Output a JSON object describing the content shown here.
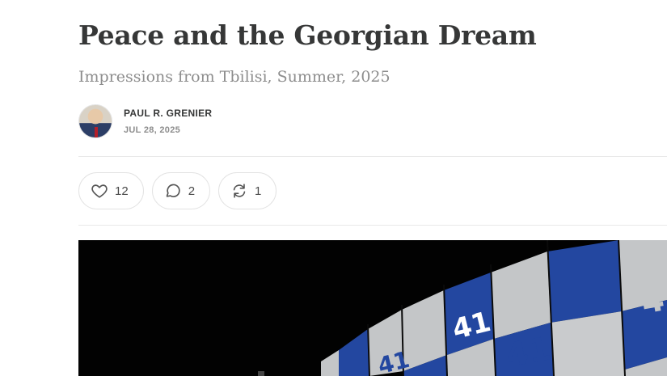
{
  "post": {
    "title": "Peace and the Georgian Dream",
    "subtitle": "Impressions from Tbilisi, Summer, 2025",
    "author": "PAUL R. GRENIER",
    "date": "JUL 28, 2025"
  },
  "actions": {
    "likes": "12",
    "comments": "2",
    "restacks": "1"
  },
  "hero": {
    "banner_text": "41",
    "colors": {
      "blue": "#2347a0",
      "grey": "#c4c6c8",
      "background": "#020202"
    }
  }
}
